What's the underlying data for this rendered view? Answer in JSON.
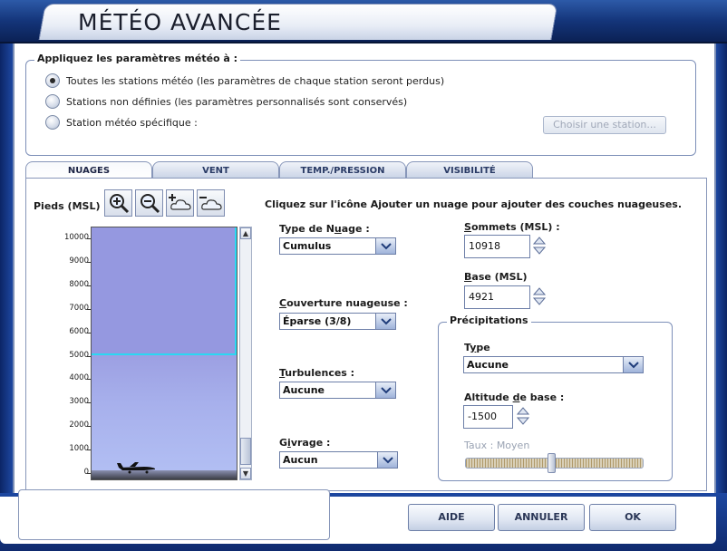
{
  "window": {
    "title": "MÉTÉO AVANCÉE"
  },
  "apply": {
    "legend": "Appliquez les paramètres météo à :",
    "options": [
      {
        "label": "Toutes les stations météo (les paramètres de chaque station seront perdus)",
        "checked": true
      },
      {
        "label": "Stations non définies (les paramètres personnalisés sont conservés)",
        "checked": false
      },
      {
        "label": "Station météo spécifique :",
        "checked": false
      }
    ],
    "choose_button": "Choisir une station..."
  },
  "tabs": [
    {
      "label": "NUAGES",
      "active": true
    },
    {
      "label": "VENT",
      "active": false
    },
    {
      "label": "TEMP./PRESSION",
      "active": false
    },
    {
      "label": "VISIBILITÉ",
      "active": false
    }
  ],
  "clouds": {
    "axis_label": "Pieds (MSL)",
    "hint": "Cliquez sur l'icône Ajouter un nuage pour ajouter des couches nuageuses.",
    "ticks": [
      "10000",
      "9000",
      "8000",
      "7000",
      "6000",
      "5000",
      "4000",
      "3000",
      "2000",
      "1000",
      "0"
    ],
    "cloud_type_label": "Type de Nuage :",
    "cloud_type_value": "Cumulus",
    "coverage_label": "Couverture nuageuse :",
    "coverage_value": "Éparse (3/8)",
    "turbulence_label": "Turbulences :",
    "turbulence_value": "Aucune",
    "icing_label": "Givrage :",
    "icing_value": "Aucun",
    "tops_label": "Sommets (MSL) :",
    "tops_value": "10918",
    "base_label": "Base (MSL)",
    "base_value": "4921"
  },
  "precip": {
    "legend": "Précipitations",
    "type_label": "Type",
    "type_value": "Aucune",
    "base_alt_label": "Altitude de base :",
    "base_alt_value": "-1500",
    "rate_label": "Taux : Moyen",
    "rate_fraction": 0.48
  },
  "buttons": {
    "help": "AIDE",
    "cancel": "ANNULER",
    "ok": "OK"
  }
}
